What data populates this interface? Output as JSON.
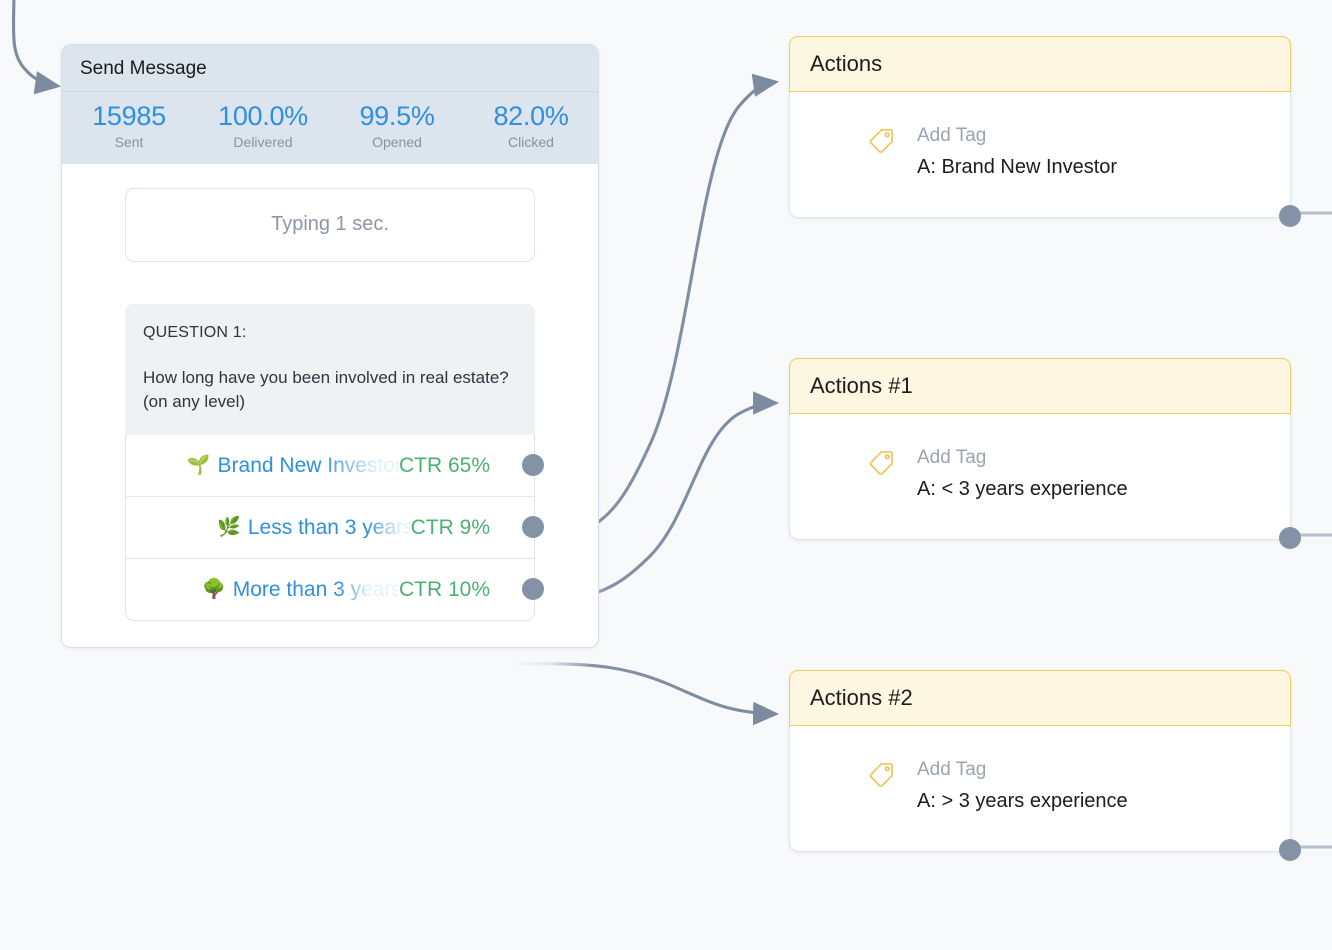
{
  "canvas": {
    "background": "#f7f9fb",
    "accent_blue": "#2f8fe0",
    "accent_green": "#4cb072",
    "accent_gold": "#f2cd60",
    "connector_color": "#8492a6"
  },
  "send_message_node": {
    "title": "Send Message",
    "stats": [
      {
        "value": "15985",
        "label": "Sent"
      },
      {
        "value": "100.0%",
        "label": "Delivered"
      },
      {
        "value": "99.5%",
        "label": "Opened"
      },
      {
        "value": "82.0%",
        "label": "Clicked"
      }
    ],
    "typing_delay": "Typing 1 sec.",
    "question": {
      "label": "QUESTION 1:",
      "text": "How long have you been involved in real estate? (on any level)"
    },
    "answers": [
      {
        "emoji": "🌱",
        "emoji_name": "seedling-emoji",
        "label": "Brand New Investor",
        "visible_label": "Brand Ne",
        "ctr": "CTR 65%"
      },
      {
        "emoji": "🌿",
        "emoji_name": "herb-emoji",
        "label": "Less than 3 years",
        "visible_label": "Less than 3 y",
        "ctr": "CTR 9%"
      },
      {
        "emoji": "🌳",
        "emoji_name": "tree-emoji",
        "label": "More than 3 years",
        "visible_label": "More than 3",
        "ctr": "CTR 10%"
      }
    ]
  },
  "action_nodes": [
    {
      "title": "Actions",
      "action_kind": "Add Tag",
      "action_value": "A: Brand New Investor"
    },
    {
      "title": "Actions #1",
      "action_kind": "Add Tag",
      "action_value": "A: < 3 years experience"
    },
    {
      "title": "Actions #2",
      "action_kind": "Add Tag",
      "action_value": "A: > 3 years experience"
    }
  ]
}
